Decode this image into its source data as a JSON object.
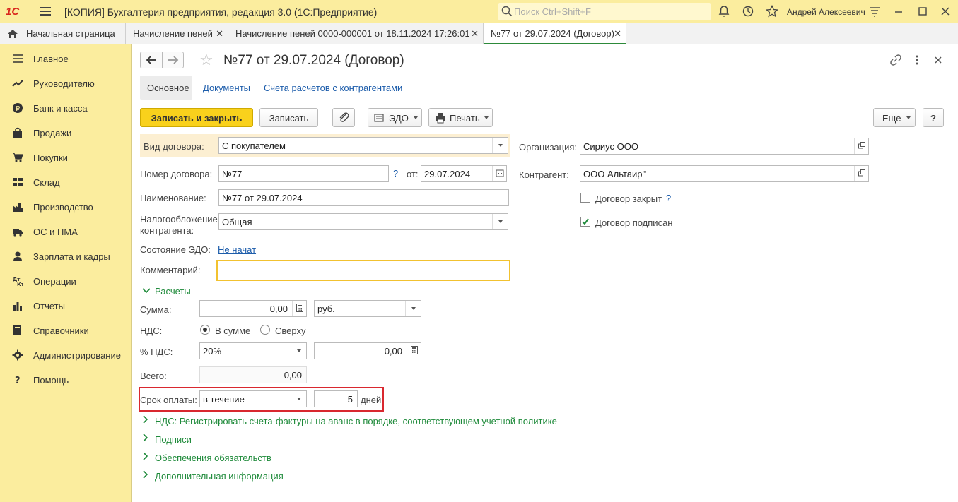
{
  "window": {
    "logo": "1С",
    "title": "[КОПИЯ] Бухгалтерия предприятия, редакция 3.0  (1С:Предприятие)",
    "search_placeholder": "Поиск Ctrl+Shift+F",
    "user": "Андрей Алексеевич"
  },
  "tabs": [
    {
      "label": "Начальная страница",
      "closable": false
    },
    {
      "label": "Начисление пеней",
      "closable": true
    },
    {
      "label": "Начисление пеней 0000-000001 от 18.11.2024 17:26:01",
      "closable": true
    },
    {
      "label": "№77 от 29.07.2024 (Договор)",
      "closable": true,
      "active": true
    }
  ],
  "sidebar": {
    "items": [
      {
        "label": "Главное",
        "icon": "menu-lines-icon"
      },
      {
        "label": "Руководителю",
        "icon": "trend-icon"
      },
      {
        "label": "Банк и касса",
        "icon": "ruble-coin-icon"
      },
      {
        "label": "Продажи",
        "icon": "shopping-bag-icon"
      },
      {
        "label": "Покупки",
        "icon": "cart-icon"
      },
      {
        "label": "Склад",
        "icon": "warehouse-grid-icon"
      },
      {
        "label": "Производство",
        "icon": "factory-icon"
      },
      {
        "label": "ОС и НМА",
        "icon": "truck-icon"
      },
      {
        "label": "Зарплата и кадры",
        "icon": "person-icon"
      },
      {
        "label": "Операции",
        "icon": "dt-kt-icon"
      },
      {
        "label": "Отчеты",
        "icon": "bar-chart-icon"
      },
      {
        "label": "Справочники",
        "icon": "books-icon"
      },
      {
        "label": "Администрирование",
        "icon": "gear-icon"
      },
      {
        "label": "Помощь",
        "icon": "question-icon"
      }
    ]
  },
  "document": {
    "title": "№77 от 29.07.2024 (Договор)",
    "subtabs": [
      "Основное",
      "Документы",
      "Счета расчетов с контрагентами"
    ]
  },
  "toolbar": {
    "save_close": "Записать и закрыть",
    "save": "Записать",
    "edo": "ЭДО",
    "print": "Печать",
    "more": "Еще",
    "help": "?"
  },
  "form": {
    "contract_type_label": "Вид договора:",
    "contract_type": "С покупателем",
    "number_label": "Номер договора:",
    "number": "№77",
    "number_q": "?",
    "date_label": "от:",
    "date": "29.07.2024",
    "name_label": "Наименование:",
    "name": "№77 от 29.07.2024",
    "tax_label_1": "Налогообложение",
    "tax_label_2": "контрагента:",
    "tax": "Общая",
    "edo_state_label": "Состояние ЭДО:",
    "edo_state": "Не начат",
    "comment_label": "Комментарий:",
    "comment": "",
    "org_label": "Организация:",
    "org": "Сириус ООО",
    "counterparty_label": "Контрагент:",
    "counterparty": "ООО Альтаир\"",
    "closed_label": "Договор закрыт",
    "closed_q": "?",
    "closed": false,
    "signed_label": "Договор подписан",
    "signed": true
  },
  "payments": {
    "section": "Расчеты",
    "sum_label": "Сумма:",
    "sum": "0,00",
    "currency": "руб.",
    "vat_label": "НДС:",
    "vat_in_sum": "В сумме",
    "vat_over": "Сверху",
    "vat_mode": "in_sum",
    "vat_rate_label": "% НДС:",
    "vat_rate": "20%",
    "vat_amount": "0,00",
    "total_label": "Всего:",
    "total": "0,00",
    "term_label": "Срок оплаты:",
    "term_mode": "в течение",
    "term_days": "5",
    "term_unit": "дней"
  },
  "sections": [
    "НДС: Регистрировать счета-фактуры на аванс в порядке, соответствующем учетной политике",
    "Подписи",
    "Обеспечения обязательств",
    "Дополнительная информация"
  ],
  "colors": {
    "accent_yellow": "#fbed9e",
    "primary_button": "#f9d11c",
    "link_blue": "#1d5dab",
    "section_green": "#1e8a3a",
    "highlight_red": "#d9282f"
  }
}
